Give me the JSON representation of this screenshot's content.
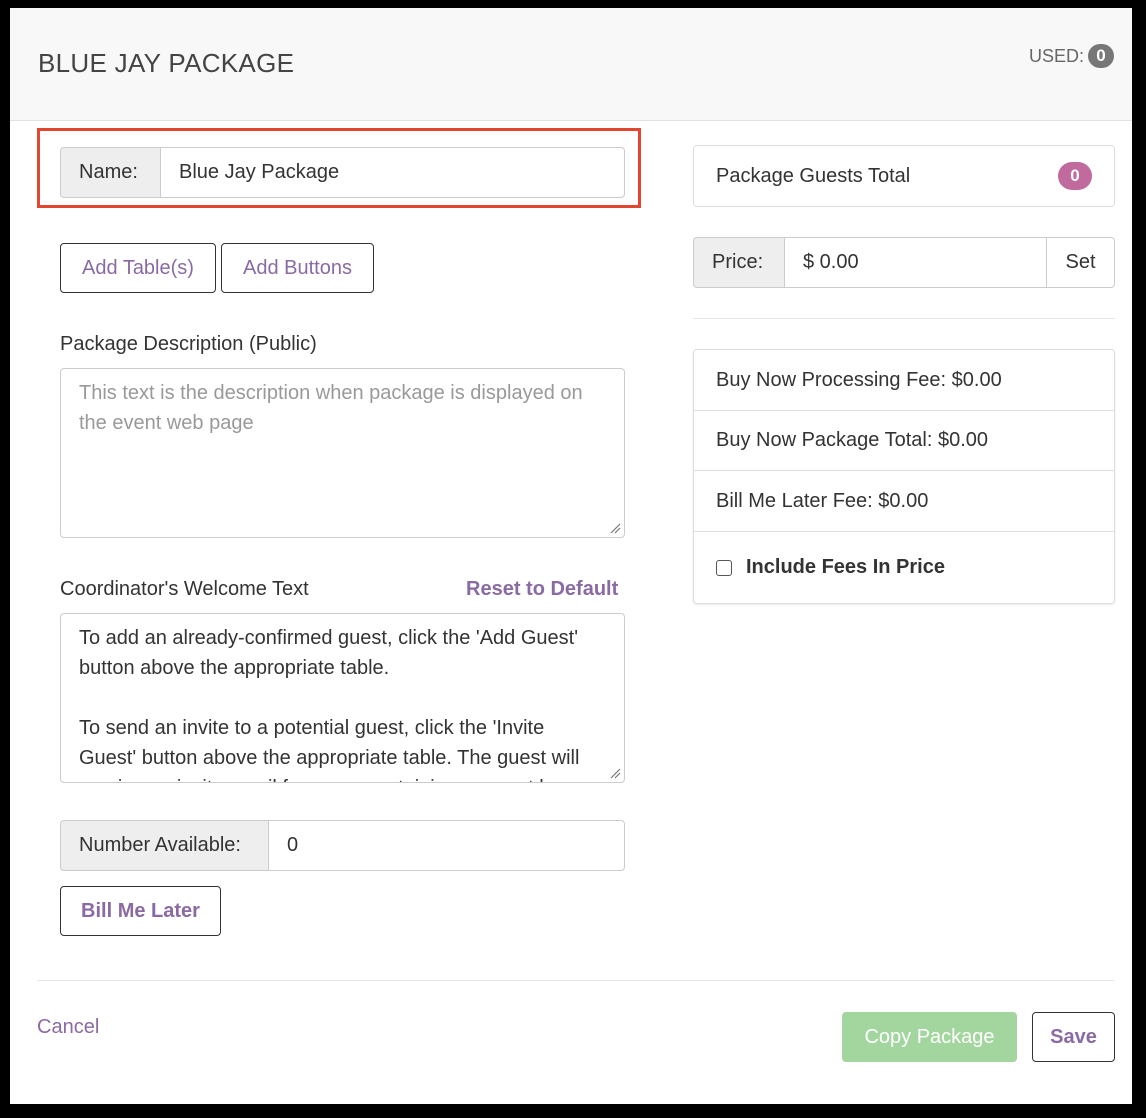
{
  "header": {
    "title": "BLUE JAY PACKAGE",
    "used_label": "USED:",
    "used_count": "0"
  },
  "name_field": {
    "label": "Name:",
    "value": "Blue Jay Package"
  },
  "buttons": {
    "add_tables": "Add Table(s)",
    "add_buttons": "Add Buttons",
    "bill_me_later": "Bill Me Later",
    "copy_package": "Copy Package",
    "save": "Save",
    "cancel": "Cancel",
    "reset_to_default": "Reset to Default",
    "set": "Set"
  },
  "description": {
    "label": "Package Description (Public)",
    "placeholder": "This text is the description when package is displayed on the event web page"
  },
  "welcome": {
    "label": "Coordinator's Welcome Text",
    "paragraph1": "To add an already-confirmed guest, click the 'Add Guest' button above the appropriate table.",
    "paragraph2": "To send an invite to a potential guest, click the 'Invite Guest' button above the appropriate table. The guest will receive an invite email from you containing a secret key"
  },
  "number_available": {
    "label": "Number Available:",
    "value": "0"
  },
  "guests_total": {
    "label": "Package Guests Total",
    "count": "0"
  },
  "price": {
    "label": "Price:",
    "value": "$ 0.00"
  },
  "fees": {
    "processing_fee": "Buy Now Processing Fee: $0.00",
    "package_total": "Buy Now Package Total: $0.00",
    "bill_later_fee": "Bill Me Later Fee: $0.00",
    "include_fees_label": "Include Fees In Price",
    "include_fees_checked": false
  },
  "colors": {
    "accent_purple": "#8a6aa3",
    "highlight_red": "#e2462e",
    "copy_button_green": "#a3d69f",
    "badge_pink": "#c06a9e"
  }
}
